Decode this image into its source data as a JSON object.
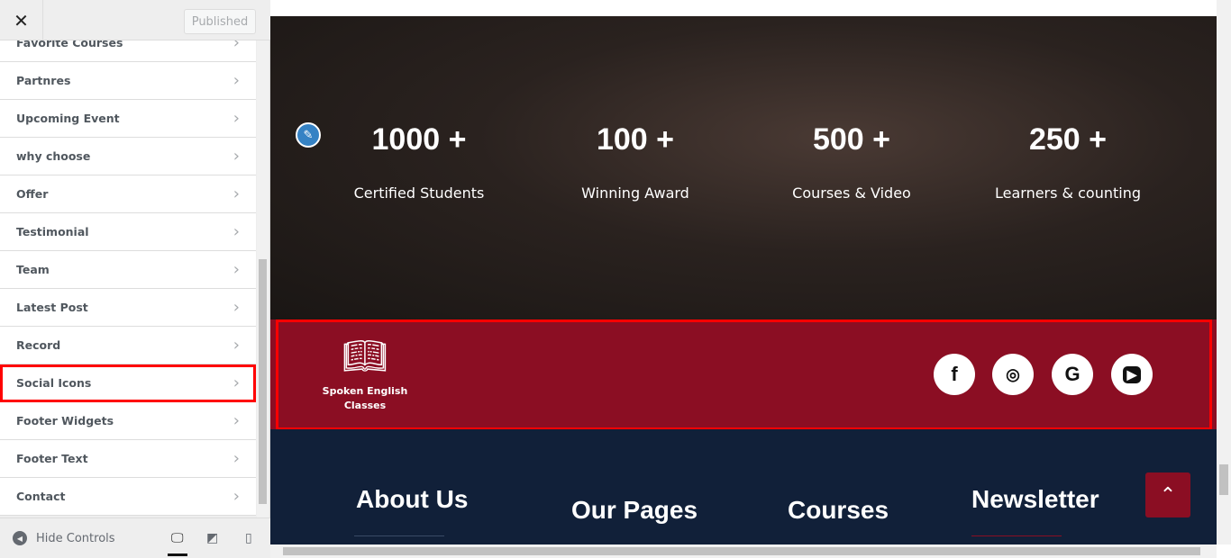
{
  "sidebar": {
    "published_label": "Published",
    "items": [
      {
        "label": "Favorite Courses"
      },
      {
        "label": "Partnres"
      },
      {
        "label": "Upcoming Event"
      },
      {
        "label": "why choose"
      },
      {
        "label": "Offer"
      },
      {
        "label": "Testimonial"
      },
      {
        "label": "Team"
      },
      {
        "label": "Latest Post"
      },
      {
        "label": "Record"
      },
      {
        "label": "Social Icons"
      },
      {
        "label": "Footer Widgets"
      },
      {
        "label": "Footer Text"
      },
      {
        "label": "Contact"
      }
    ],
    "hide_controls": "Hide Controls"
  },
  "stats": [
    {
      "number": "1000 +",
      "label": "Certified Students"
    },
    {
      "number": "100 +",
      "label": "Winning Award"
    },
    {
      "number": "500 +",
      "label": "Courses & Video"
    },
    {
      "number": "250 +",
      "label": "Learners & counting"
    }
  ],
  "logo": {
    "text": "Spoken English Classes"
  },
  "social": [
    "facebook-icon",
    "instagram-icon",
    "google-icon",
    "youtube-icon"
  ],
  "footer_headings": [
    "About Us",
    "Our Pages",
    "Courses",
    "Newsletter"
  ],
  "colors": {
    "brand_red": "#8b0e23",
    "navy": "#112039",
    "highlight": "#ff0000"
  }
}
